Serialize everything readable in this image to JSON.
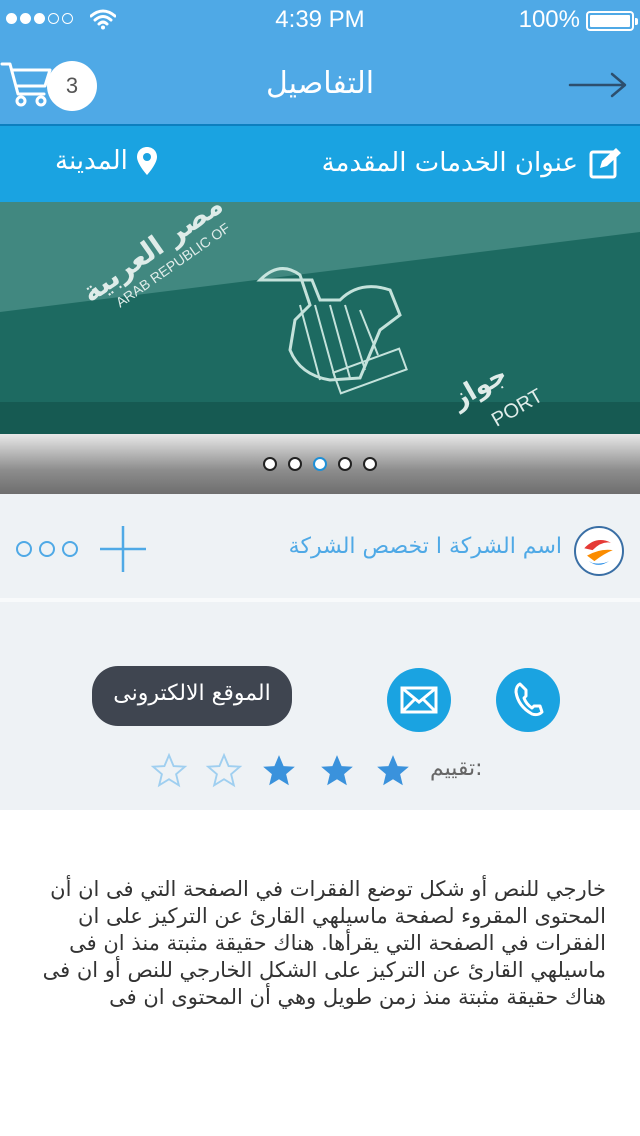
{
  "status_bar": {
    "time": "4:39 PM",
    "battery": "100%"
  },
  "nav": {
    "title": "التفاصيل",
    "cart_count": "3",
    "icons": [
      "cart-icon",
      "back-arrow-icon"
    ]
  },
  "sub_header": {
    "services_title": "عنوان الخدمات المقدمة",
    "city": "المدينة",
    "icons": [
      "edit-icon",
      "location-pin-icon"
    ]
  },
  "carousel": {
    "page_count": 5,
    "active_index": 2,
    "image_text": [
      "مصر العربية",
      "ARAB REPUBLIC OF",
      "جواز",
      "PORT"
    ]
  },
  "company": {
    "name": "اسم الشركة ا تخصص الشركة",
    "icons": [
      "company-logo",
      "more-icon",
      "plus-icon"
    ]
  },
  "actions": {
    "website_label": "الموقع الالكترونى",
    "icons": [
      "mail-icon",
      "phone-icon"
    ]
  },
  "rating": {
    "label": "تقييم:",
    "value": 3,
    "max": 5
  },
  "description": "خارجي للنص أو شكل توضع الفقرات في الصفحة التي فى ان أن المحتوى المقروء لصفحة ماسيلهي القارئ عن التركيز على ان الفقرات في الصفحة التي يقرأها. هناك حقيقة مثبتة منذ ان فى ماسيلهي القارئ عن التركيز على الشكل الخارجي للنص أو ان فى هناك حقيقة مثبتة منذ زمن طويل وهي أن المحتوى ان فى",
  "colors": {
    "primary": "#4fa9e6",
    "accent": "#1aa3e1",
    "dark_button": "#3f4550",
    "panel_bg": "#eef2f5"
  }
}
